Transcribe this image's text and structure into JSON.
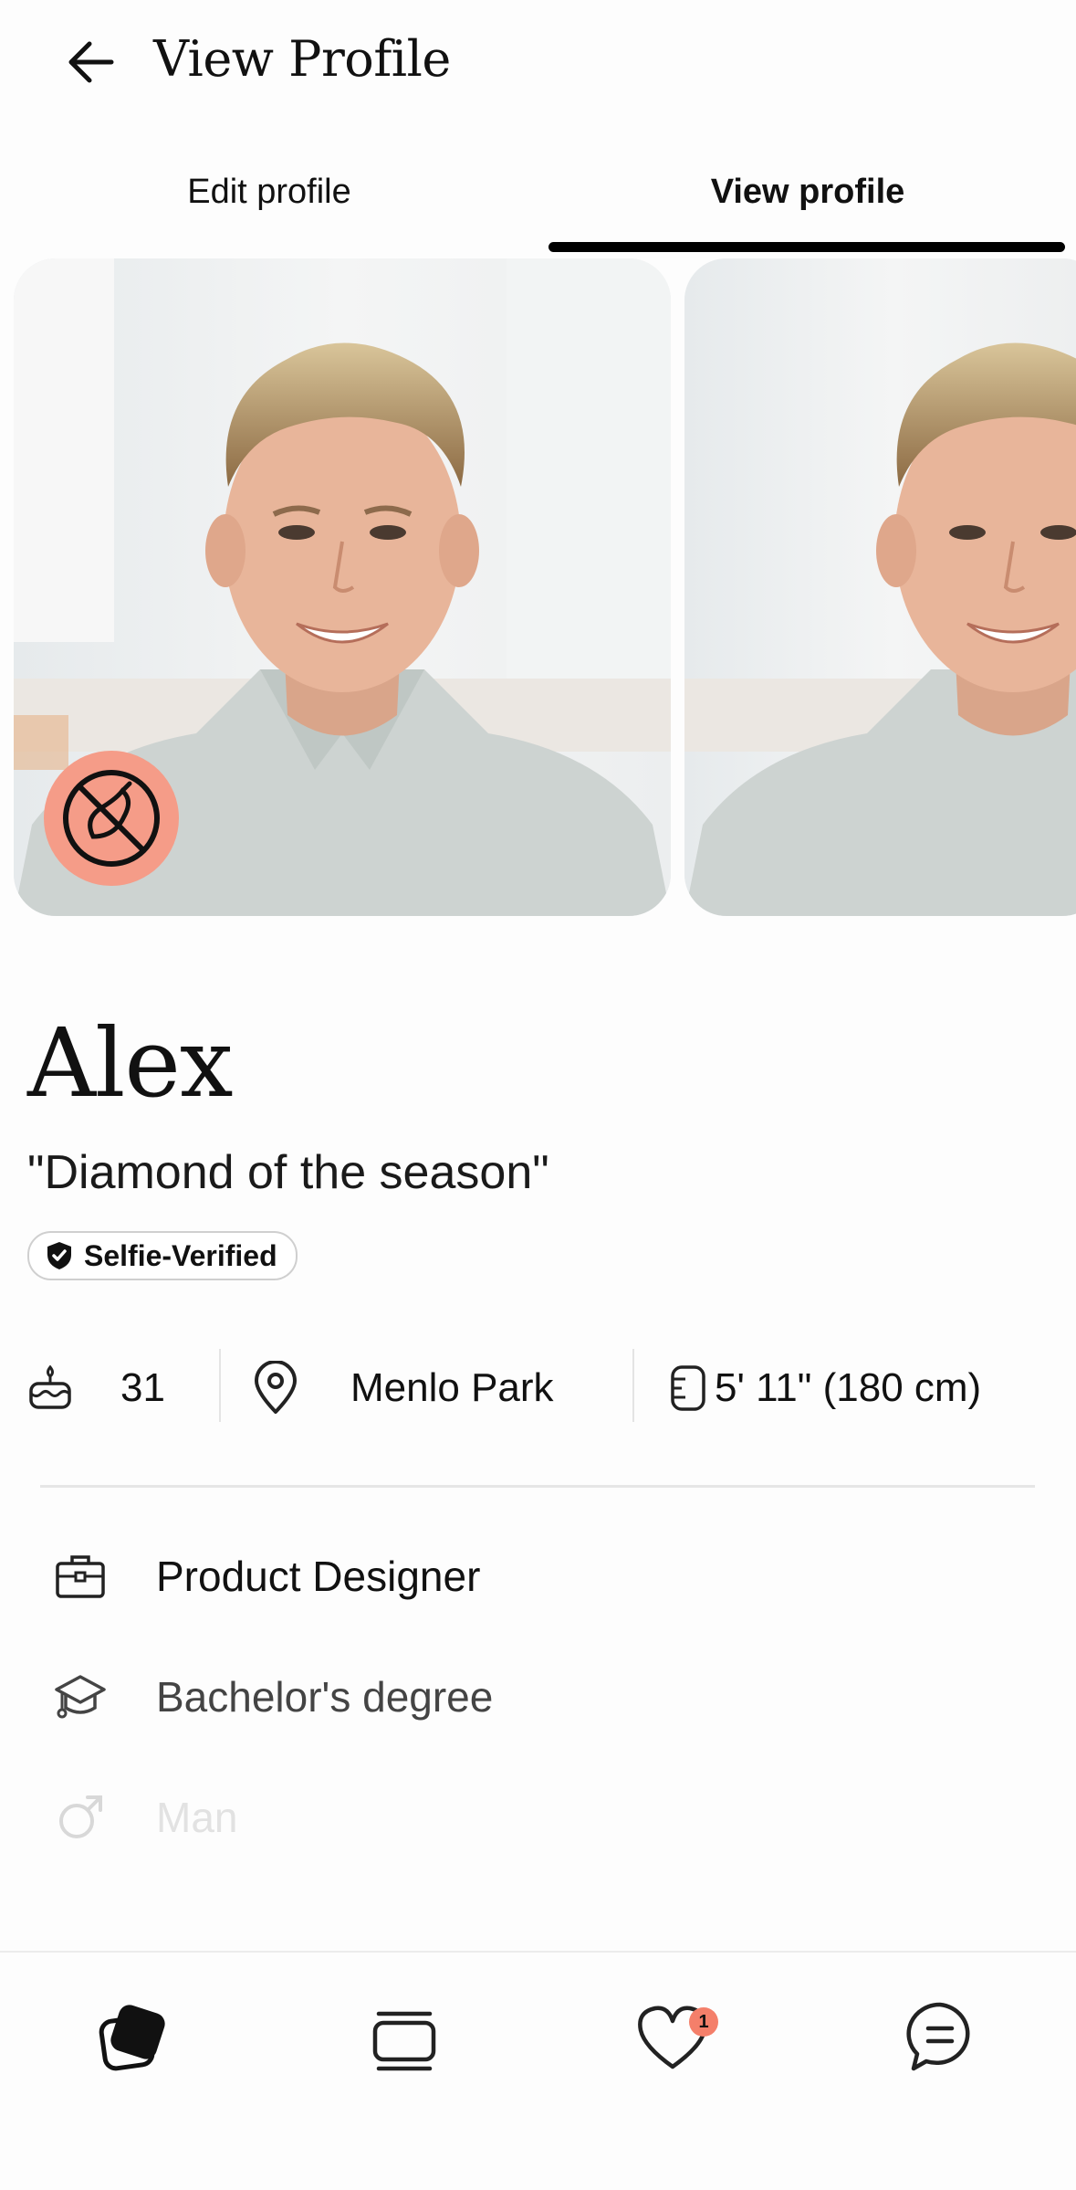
{
  "header": {
    "title": "View Profile",
    "back_icon": "arrow-left-icon"
  },
  "tabs": [
    {
      "label": "Edit profile",
      "active": false
    },
    {
      "label": "View profile",
      "active": true
    }
  ],
  "photos": {
    "count_visible": 2,
    "overlay_icon": "no-eggplant-icon",
    "overlay_color": "#f59c88"
  },
  "profile": {
    "name": "Alex",
    "tagline": "\"Diamond of the season\"",
    "verified_label": "Selfie-Verified"
  },
  "stats": {
    "age": "31",
    "location": "Menlo Park",
    "height": "5' 11\" (180 cm)"
  },
  "details": [
    {
      "icon": "briefcase-icon",
      "text": "Product Designer"
    },
    {
      "icon": "graduation-cap-icon",
      "text": "Bachelor's degree"
    },
    {
      "icon": "male-symbol-icon",
      "text": "Man"
    }
  ],
  "bottom_nav": {
    "items": [
      "cards-icon",
      "stack-icon",
      "heart-icon",
      "chat-bubble-icon"
    ],
    "likes_badge": "1",
    "badge_color": "#f47f6a"
  }
}
